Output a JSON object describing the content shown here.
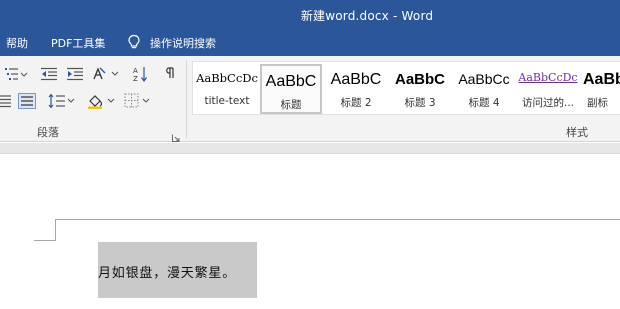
{
  "titlebar": {
    "title": "新建word.docx  -  Word"
  },
  "menu": {
    "help": "帮助",
    "pdf_tools": "PDF工具集",
    "tell_me": "操作说明搜索"
  },
  "ribbon": {
    "paragraph_group_label": "段落",
    "styles_group_label": "样式",
    "styles": [
      {
        "sample": "AaBbCcDc",
        "label": "title-text"
      },
      {
        "sample": "AaBbC",
        "label": "标题"
      },
      {
        "sample": "AaBbC",
        "label": "标题 2"
      },
      {
        "sample": "AaBbC",
        "label": "标题 3"
      },
      {
        "sample": "AaBbCc",
        "label": "标题 4"
      },
      {
        "sample": "AaBbCcDc",
        "label": "访问过的..."
      },
      {
        "sample": "AaBb",
        "label": "副标"
      }
    ],
    "hyperlink_style_color": "#7030a0"
  },
  "document": {
    "text": "月如银盘，漫天繁星。",
    "highlight_color": "#c9c9c9"
  },
  "colors": {
    "title_bar": "#2b579a",
    "ribbon_bg": "#f3f3f3"
  }
}
